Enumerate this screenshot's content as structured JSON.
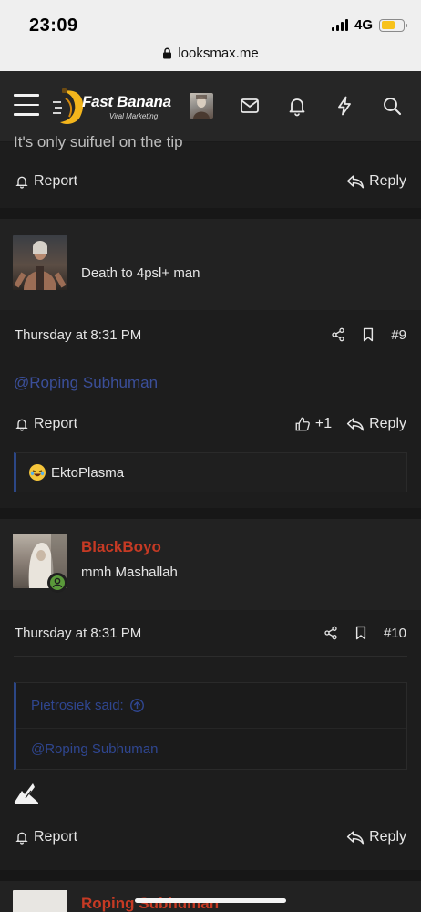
{
  "status_bar": {
    "time": "23:09",
    "network": "4G",
    "url": "looksmax.me"
  },
  "header": {
    "logo_title": "Fast Banana",
    "logo_subtitle": "Viral Marketing"
  },
  "previous_post": {
    "text_fragment": "It's only suifuel on the tip",
    "report_label": "Report",
    "reply_label": "Reply"
  },
  "posts": [
    {
      "username": "",
      "user_title": "Death to 4psl+ man",
      "date": "Thursday at 8:31 PM",
      "number": "#9",
      "mention": "@Roping Subhuman",
      "report_label": "Report",
      "like_count": "+1",
      "reply_label": "Reply",
      "reactor": "EktoPlasma"
    },
    {
      "username": "BlackBoyo",
      "user_title": "mmh Mashallah",
      "date": "Thursday at 8:31 PM",
      "number": "#10",
      "quote_author": "Pietrosiek said:",
      "quote_text": "@Roping Subhuman",
      "report_label": "Report",
      "reply_label": "Reply"
    },
    {
      "username": "Roping Subhuman"
    }
  ],
  "colors": {
    "accent_red": "#c63a24",
    "link_blue": "#3b4f9a",
    "quote_bar": "#2c4786",
    "online_green": "#5a9a3a",
    "logo_yellow": "#f3b51c"
  }
}
